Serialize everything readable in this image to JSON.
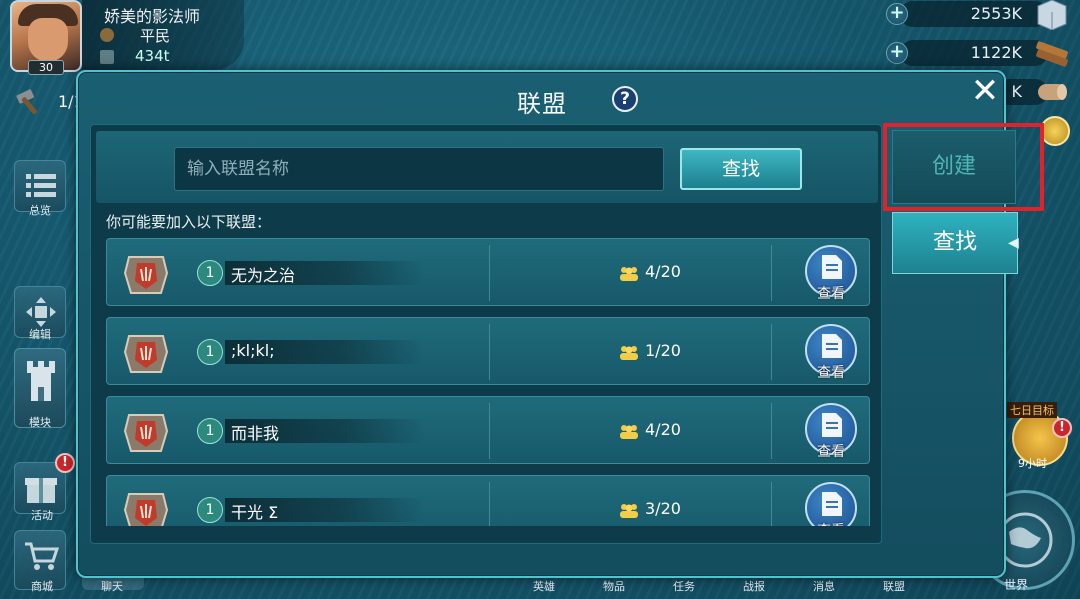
{
  "player": {
    "name": "娇美的影法师",
    "rank": "平民",
    "power": "434t",
    "level": "30"
  },
  "builders": {
    "count": "1/1"
  },
  "resources": [
    {
      "name": "food",
      "value": "2553K",
      "icon": "crate-icon"
    },
    {
      "name": "wood",
      "value": "1122K",
      "icon": "wood-planks-icon"
    },
    {
      "name": "stone",
      "value": "K",
      "icon": "log-icon"
    },
    {
      "name": "gold",
      "value": "",
      "icon": "gold-coin-icon"
    }
  ],
  "side_buttons": {
    "overview": "总览",
    "edit": "编辑",
    "module": "模块",
    "events": "活动",
    "events_badge": "!",
    "shop": "商城",
    "chat": "聊天"
  },
  "bottom_nav": [
    "英雄",
    "物品",
    "任务",
    "战报",
    "消息",
    "联盟"
  ],
  "dialog": {
    "title": "联盟",
    "help": "?",
    "close": "✕",
    "search_placeholder": "输入联盟名称",
    "search_button": "查找",
    "hint": "你可能要加入以下联盟："
  },
  "alliances": [
    {
      "level": "1",
      "name": "无为之治",
      "members": "4/20",
      "view": "查看"
    },
    {
      "level": "1",
      "name": ";kl;kl;",
      "members": "1/20",
      "view": "查看"
    },
    {
      "level": "1",
      "name": "而非我",
      "members": "4/20",
      "view": "查看"
    },
    {
      "level": "1",
      "name": "干光 Σ",
      "members": "3/20",
      "view": "查看"
    }
  ],
  "tabs": {
    "create": "创建",
    "search": "查找"
  },
  "extras": {
    "seven_day": "七日目标",
    "seven_day_time": "9小时",
    "world": "世界",
    "badge": "!"
  },
  "colors": {
    "highlight": "#e1222b",
    "accent": "#3fb7c2",
    "panel": "#134d5e"
  }
}
